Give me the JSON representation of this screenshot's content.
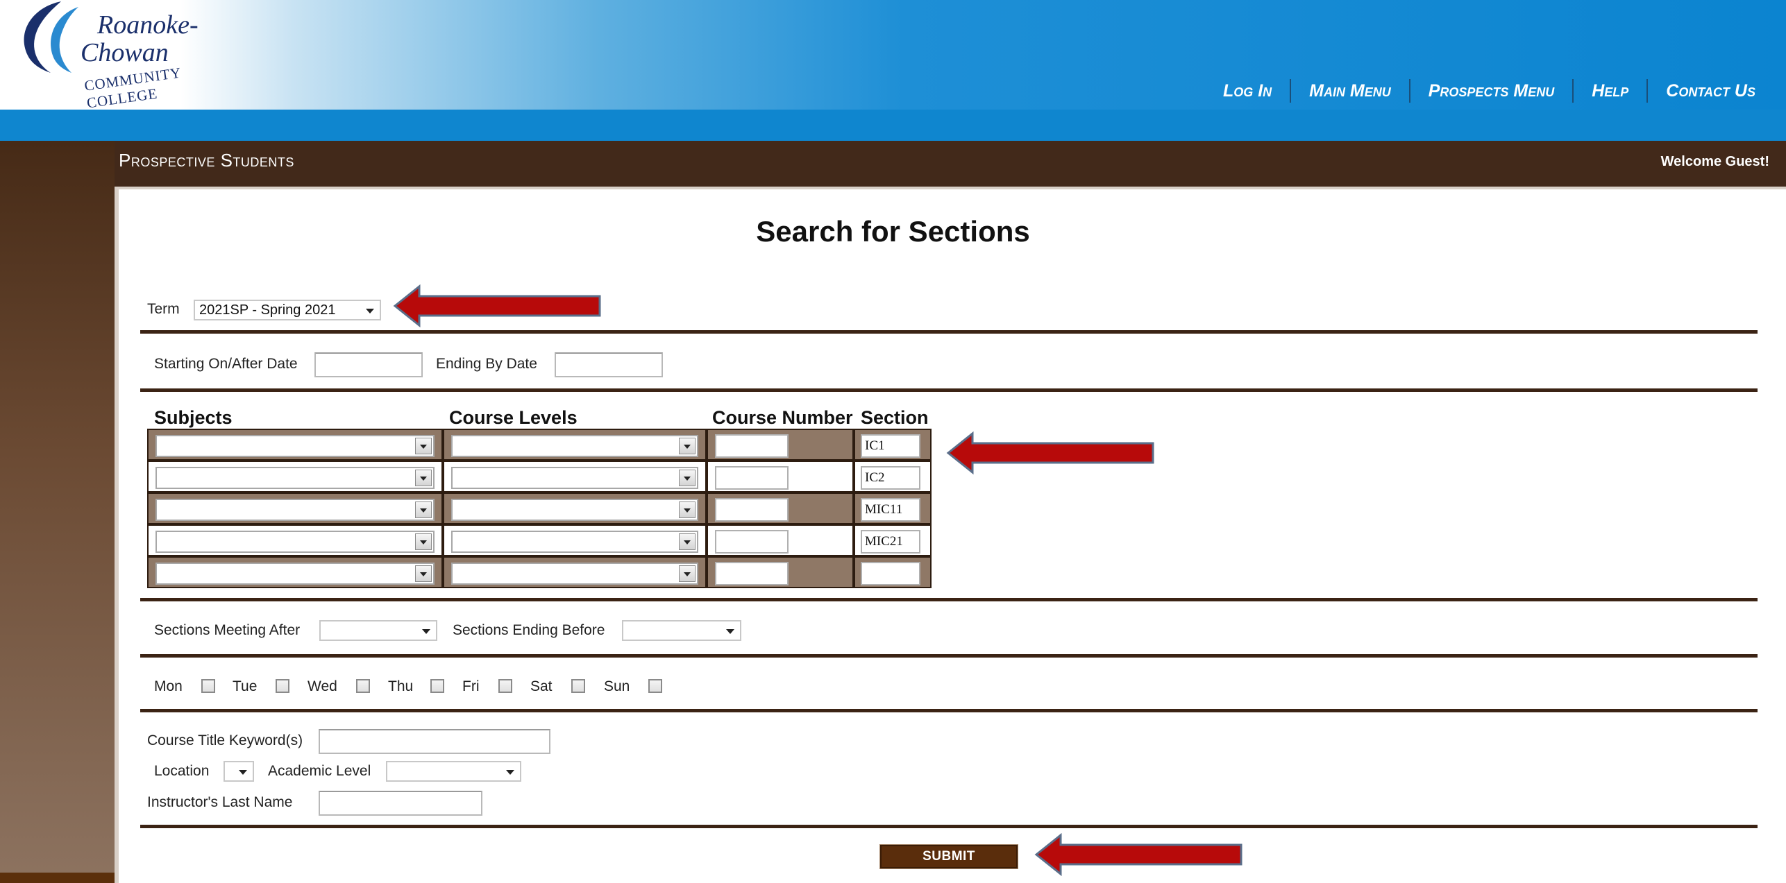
{
  "header": {
    "logo_line1": "Roanoke-",
    "logo_line2": "Chowan",
    "logo_line3": "COMMUNITY COLLEGE",
    "nav": [
      {
        "label": "Log In"
      },
      {
        "label": "Main Menu"
      },
      {
        "label": "Prospects Menu"
      },
      {
        "label": "Help"
      },
      {
        "label": "Contact Us"
      }
    ]
  },
  "page": {
    "heading": "Prospective Students",
    "welcome": "Welcome Guest!",
    "title": "Search for Sections"
  },
  "term": {
    "label": "Term",
    "value": "2021SP - Spring 2021"
  },
  "dates": {
    "start_label": "Starting On/After Date",
    "end_label": "Ending By Date",
    "start_value": "",
    "end_value": ""
  },
  "grid": {
    "headers": {
      "subjects": "Subjects",
      "levels": "Course Levels",
      "number": "Course Number",
      "section": "Section"
    },
    "rows": [
      {
        "subject": "",
        "level": "",
        "number": "",
        "section": "IC1"
      },
      {
        "subject": "",
        "level": "",
        "number": "",
        "section": "IC2"
      },
      {
        "subject": "",
        "level": "",
        "number": "",
        "section": "MIC11"
      },
      {
        "subject": "",
        "level": "",
        "number": "",
        "section": "MIC21"
      },
      {
        "subject": "",
        "level": "",
        "number": "",
        "section": ""
      }
    ]
  },
  "times": {
    "after_label": "Sections Meeting After",
    "before_label": "Sections Ending Before",
    "after_value": "",
    "before_value": ""
  },
  "days": [
    {
      "label": "Mon",
      "checked": false
    },
    {
      "label": "Tue",
      "checked": false
    },
    {
      "label": "Wed",
      "checked": false
    },
    {
      "label": "Thu",
      "checked": false
    },
    {
      "label": "Fri",
      "checked": false
    },
    {
      "label": "Sat",
      "checked": false
    },
    {
      "label": "Sun",
      "checked": false
    }
  ],
  "filters": {
    "keyword_label": "Course Title Keyword(s)",
    "location_label": "Location",
    "academic_level_label": "Academic Level",
    "instructor_label": "Instructor's Last Name",
    "keyword_value": "",
    "location_value": "",
    "academic_level_value": "",
    "instructor_value": ""
  },
  "submit_label": "SUBMIT",
  "colors": {
    "header_blue": "#0b84d0",
    "brown": "#42291a",
    "arrow_red": "#b70a0a",
    "submit": "#5a2d0c"
  }
}
